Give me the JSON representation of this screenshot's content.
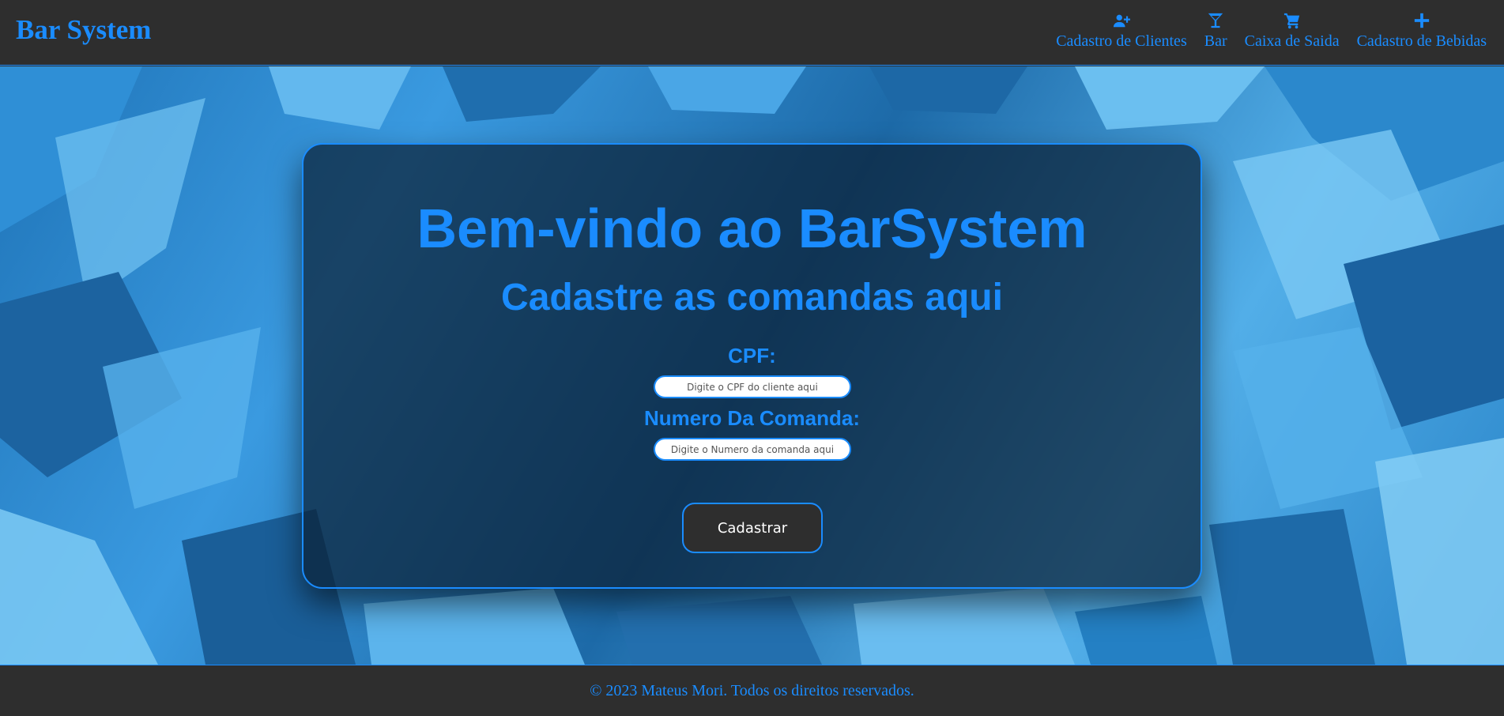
{
  "navbar": {
    "brand": "Bar System",
    "items": [
      {
        "label": "Cadastro de Clientes",
        "icon": "user-plus-icon"
      },
      {
        "label": "Bar",
        "icon": "cocktail-glass-icon"
      },
      {
        "label": "Caixa de Saida",
        "icon": "shopping-cart-icon"
      },
      {
        "label": "Cadastro de Bebidas",
        "icon": "plus-icon"
      }
    ]
  },
  "card": {
    "title": "Bem-vindo ao BarSystem",
    "subtitle": "Cadastre as comandas aqui",
    "cpf_label": "CPF:",
    "cpf_placeholder": "Digite o CPF do cliente aqui",
    "cpf_value": "",
    "comanda_label": "Numero Da Comanda:",
    "comanda_placeholder": "Digite o Numero da comanda aqui",
    "comanda_value": "",
    "submit_label": "Cadastrar"
  },
  "footer": {
    "text": "© 2023 Mateus Mori. Todos os direitos reservados."
  },
  "colors": {
    "accent": "#1a8cff",
    "bar_background": "#2e2e2e",
    "button_text": "#ffffff"
  }
}
